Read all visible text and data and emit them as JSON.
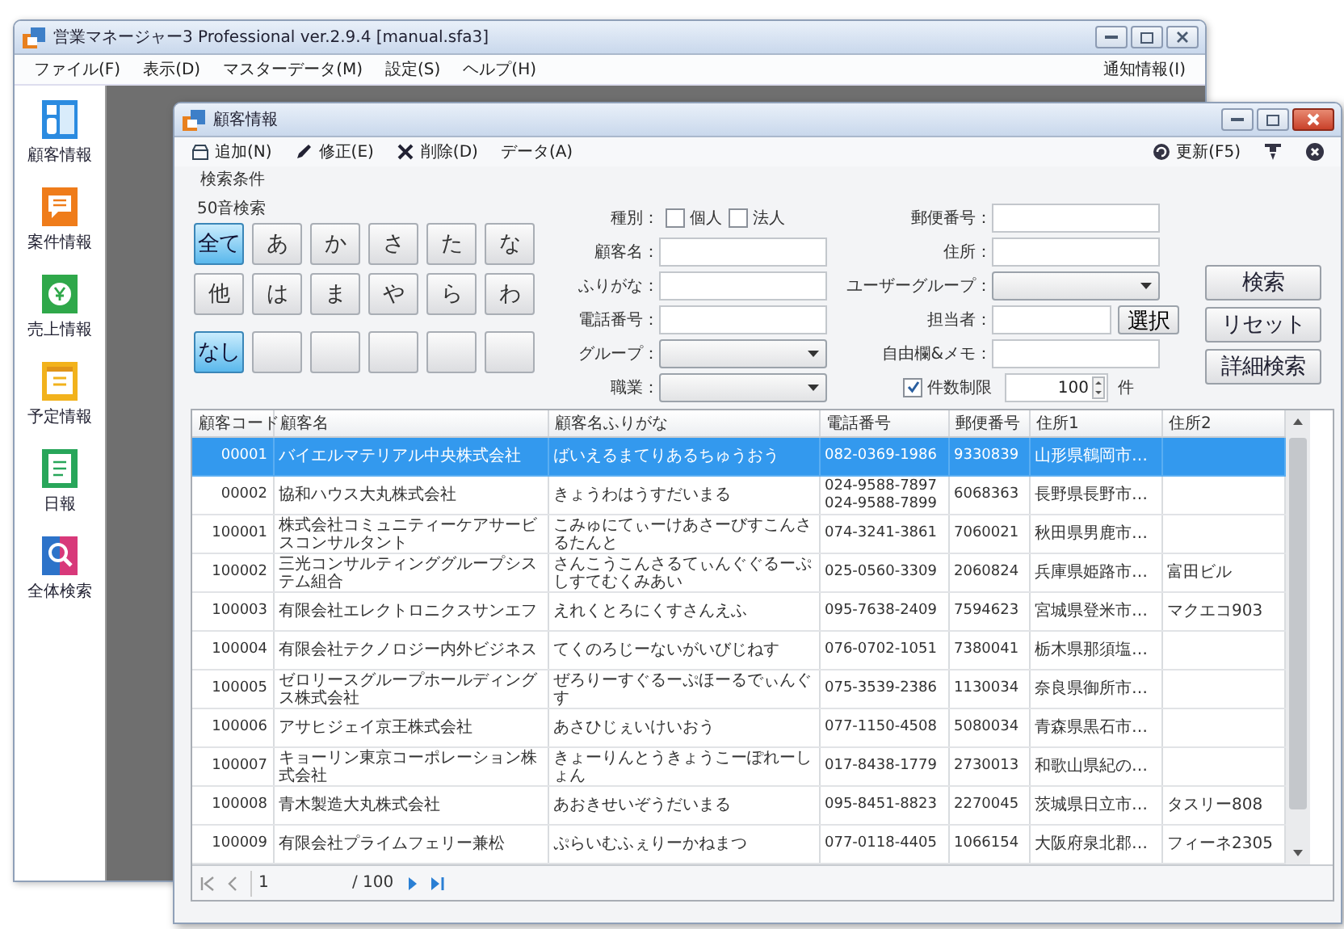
{
  "app": {
    "title": "営業マネージャー3 Professional ver.2.9.4 [manual.sfa3]",
    "menu": [
      "ファイル(F)",
      "表示(D)",
      "マスターデータ(M)",
      "設定(S)",
      "ヘルプ(H)"
    ],
    "menu_right": "通知情報(I)"
  },
  "sidebar": {
    "items": [
      {
        "label": "顧客情報",
        "kind": "customer"
      },
      {
        "label": "案件情報",
        "kind": "deal"
      },
      {
        "label": "売上情報",
        "kind": "sales"
      },
      {
        "label": "予定情報",
        "kind": "schedule"
      },
      {
        "label": "日報",
        "kind": "report"
      },
      {
        "label": "全体検索",
        "kind": "search"
      }
    ]
  },
  "child_window": {
    "title": "顧客情報",
    "toolbar": [
      {
        "label": "追加(N)",
        "kind": "add"
      },
      {
        "label": "修正(E)",
        "kind": "edit"
      },
      {
        "label": "削除(D)",
        "kind": "delete"
      },
      {
        "label": "データ(A)",
        "kind": "menu"
      }
    ],
    "refresh": "更新(F5)"
  },
  "search": {
    "section_title": "検索条件",
    "kana_title": "50音検索",
    "kana_rows": [
      [
        {
          "label": "全て",
          "selected": true
        },
        {
          "label": "あ",
          "selected": false
        },
        {
          "label": "か",
          "selected": false
        },
        {
          "label": "さ",
          "selected": false
        },
        {
          "label": "た",
          "selected": false
        },
        {
          "label": "な",
          "selected": false
        }
      ],
      [
        {
          "label": "他",
          "selected": false
        },
        {
          "label": "は",
          "selected": false
        },
        {
          "label": "ま",
          "selected": false
        },
        {
          "label": "や",
          "selected": false
        },
        {
          "label": "ら",
          "selected": false
        },
        {
          "label": "わ",
          "selected": false
        }
      ],
      [
        {
          "label": "なし",
          "selected": true
        },
        {
          "selected": false
        },
        {
          "selected": false
        },
        {
          "selected": false
        },
        {
          "selected": false
        },
        {
          "selected": false
        }
      ]
    ],
    "type": {
      "label": "種別：",
      "options": [
        {
          "label": "個人",
          "checked": false
        },
        {
          "label": "法人",
          "checked": false
        }
      ]
    },
    "fields_left": [
      {
        "label": "顧客名：",
        "kind": "text"
      },
      {
        "label": "ふりがな：",
        "kind": "text"
      },
      {
        "label": "電話番号：",
        "kind": "text"
      },
      {
        "label": "グループ：",
        "kind": "select"
      },
      {
        "label": "職業：",
        "kind": "select"
      }
    ],
    "fields_right": [
      {
        "label": "郵便番号：",
        "kind": "text"
      },
      {
        "label": "住所：",
        "kind": "text"
      },
      {
        "label": "ユーザーグループ：",
        "kind": "select"
      },
      {
        "label": "担当者：",
        "kind": "picker",
        "button": "選択"
      },
      {
        "label": "自由欄&メモ：",
        "kind": "text"
      }
    ],
    "limit": {
      "label": "件数制限",
      "checked": true,
      "value": "100",
      "unit": "件"
    },
    "buttons": [
      "検索",
      "リセット",
      "詳細検索"
    ]
  },
  "table": {
    "columns": [
      "顧客コード",
      "顧客名",
      "顧客名ふりがな",
      "電話番号",
      "郵便番号",
      "住所1",
      "住所2"
    ],
    "rows": [
      {
        "selected": true,
        "cells": [
          "00001",
          "バイエルマテリアル中央株式会社",
          "ばいえるまてりあるちゅうおう",
          "082-0369-1986",
          "9330839",
          "山形県鶴岡市…",
          ""
        ]
      },
      {
        "selected": false,
        "cells": [
          "00002",
          "協和ハウス大丸株式会社",
          "きょうわはうすだいまる",
          "024-9588-7897\n024-9588-7899",
          "6068363",
          "長野県長野市…",
          ""
        ]
      },
      {
        "selected": false,
        "cells": [
          "100001",
          "株式会社コミュニティーケアサービスコンサルタント",
          "こみゅにてぃーけあさーびすこんさるたんと",
          "074-3241-3861",
          "7060021",
          "秋田県男鹿市…",
          ""
        ]
      },
      {
        "selected": false,
        "cells": [
          "100002",
          "三光コンサルティンググループシステム組合",
          "さんこうこんさるてぃんぐぐるーぷしすてむくみあい",
          "025-0560-3309",
          "2060824",
          "兵庫県姫路市…",
          "富田ビル"
        ]
      },
      {
        "selected": false,
        "cells": [
          "100003",
          "有限会社エレクトロニクスサンエフ",
          "えれくとろにくすさんえふ",
          "095-7638-2409",
          "7594623",
          "宮城県登米市…",
          "マクエコ903"
        ]
      },
      {
        "selected": false,
        "cells": [
          "100004",
          "有限会社テクノロジー内外ビジネス",
          "てくのろじーないがいびじねす",
          "076-0702-1051",
          "7380041",
          "栃木県那須塩…",
          ""
        ]
      },
      {
        "selected": false,
        "cells": [
          "100005",
          "ゼロリースグループホールディングス株式会社",
          "ぜろりーすぐるーぷほーるでぃんぐす",
          "075-3539-2386",
          "1130034",
          "奈良県御所市…",
          ""
        ]
      },
      {
        "selected": false,
        "cells": [
          "100006",
          "アサヒジェイ京王株式会社",
          "あさひじぇいけいおう",
          "077-1150-4508",
          "5080034",
          "青森県黒石市…",
          ""
        ]
      },
      {
        "selected": false,
        "cells": [
          "100007",
          "キョーリン東京コーポレーション株式会社",
          "きょーりんとうきょうこーぽれーしょん",
          "017-8438-1779",
          "2730013",
          "和歌山県紀の…",
          ""
        ]
      },
      {
        "selected": false,
        "cells": [
          "100008",
          "青木製造大丸株式会社",
          "あおきせいぞうだいまる",
          "095-8451-8823",
          "2270045",
          "茨城県日立市…",
          "タスリー808"
        ]
      },
      {
        "selected": false,
        "cells": [
          "100009",
          "有限会社プライムフェリー兼松",
          "ぷらいむふぇりーかねまつ",
          "077-0118-4405",
          "1066154",
          "大阪府泉北郡…",
          "フィーネ2305"
        ]
      }
    ]
  },
  "pager": {
    "page": "1",
    "total": "/ 100"
  }
}
